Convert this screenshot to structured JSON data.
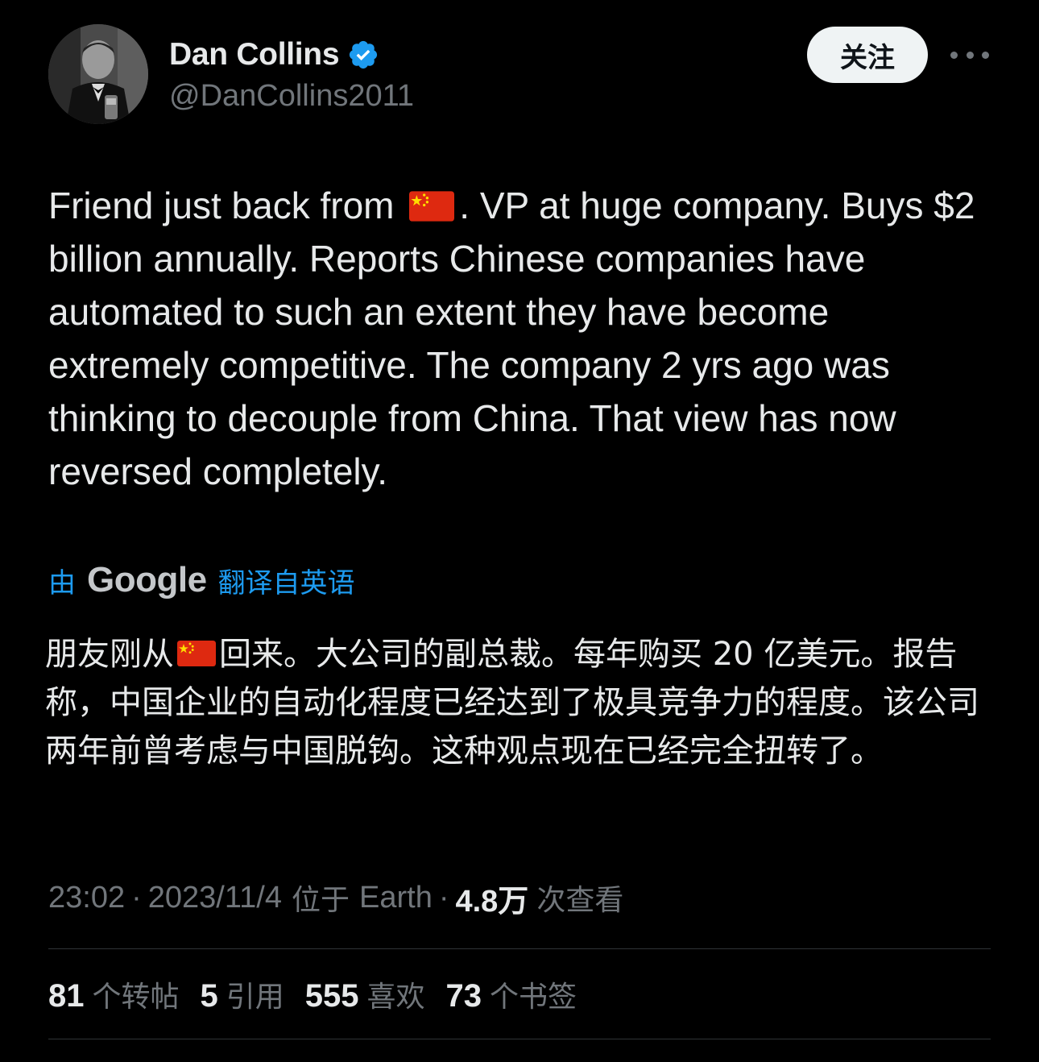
{
  "author": {
    "display_name": "Dan Collins",
    "handle": "@DanCollins2011",
    "verified": true
  },
  "header": {
    "follow_label": "关注"
  },
  "tweet": {
    "text_part1": "Friend just back from",
    "text_part2": ". VP at huge company. Buys $2 billion annually. Reports Chinese companies have automated to such an extent they have become extremely competitive. The company 2 yrs ago was thinking to decouple from China. That view has now reversed completely.",
    "flag_emoji": "china-flag"
  },
  "translation": {
    "by_label": "由",
    "provider": "Google",
    "from_label": "翻译自英语",
    "text_part1": "朋友刚从",
    "text_part2": "回来。大公司的副总裁。每年购买 20 亿美元。报告称，中国企业的自动化程度已经达到了极具竞争力的程度。该公司两年前曾考虑与中国脱钩。这种观点现在已经完全扭转了。"
  },
  "meta": {
    "time": "23:02",
    "date": "2023/11/4",
    "location_prefix": "位于",
    "location": "Earth",
    "views_count": "4.8万",
    "views_label": "次查看",
    "separator": "·"
  },
  "stats": [
    {
      "count": "81",
      "label": "个转帖"
    },
    {
      "count": "5",
      "label": "引用"
    },
    {
      "count": "555",
      "label": "喜欢"
    },
    {
      "count": "73",
      "label": "个书签"
    }
  ],
  "colors": {
    "background": "#000000",
    "text_primary": "#e7e9ea",
    "text_secondary": "#71767b",
    "accent_blue": "#1d9bf0",
    "divider": "#2f3336",
    "follow_button_bg": "#eff3f4"
  }
}
